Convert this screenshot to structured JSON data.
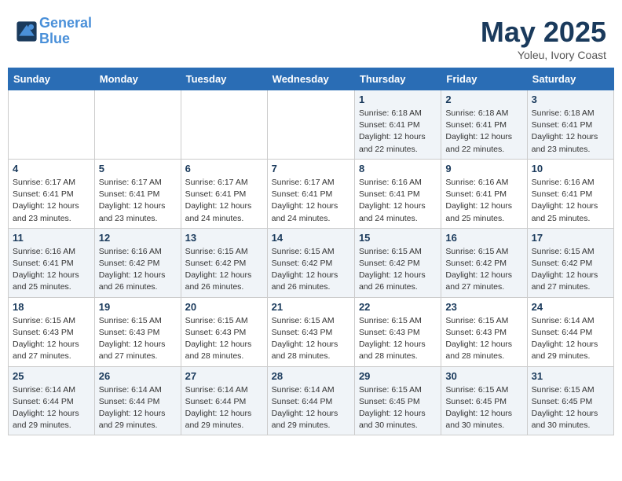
{
  "header": {
    "logo_line1": "General",
    "logo_line2": "Blue",
    "title": "May 2025",
    "subtitle": "Yoleu, Ivory Coast"
  },
  "weekdays": [
    "Sunday",
    "Monday",
    "Tuesday",
    "Wednesday",
    "Thursday",
    "Friday",
    "Saturday"
  ],
  "weeks": [
    [
      {
        "day": "",
        "info": ""
      },
      {
        "day": "",
        "info": ""
      },
      {
        "day": "",
        "info": ""
      },
      {
        "day": "",
        "info": ""
      },
      {
        "day": "1",
        "info": "Sunrise: 6:18 AM\nSunset: 6:41 PM\nDaylight: 12 hours\nand 22 minutes."
      },
      {
        "day": "2",
        "info": "Sunrise: 6:18 AM\nSunset: 6:41 PM\nDaylight: 12 hours\nand 22 minutes."
      },
      {
        "day": "3",
        "info": "Sunrise: 6:18 AM\nSunset: 6:41 PM\nDaylight: 12 hours\nand 23 minutes."
      }
    ],
    [
      {
        "day": "4",
        "info": "Sunrise: 6:17 AM\nSunset: 6:41 PM\nDaylight: 12 hours\nand 23 minutes."
      },
      {
        "day": "5",
        "info": "Sunrise: 6:17 AM\nSunset: 6:41 PM\nDaylight: 12 hours\nand 23 minutes."
      },
      {
        "day": "6",
        "info": "Sunrise: 6:17 AM\nSunset: 6:41 PM\nDaylight: 12 hours\nand 24 minutes."
      },
      {
        "day": "7",
        "info": "Sunrise: 6:17 AM\nSunset: 6:41 PM\nDaylight: 12 hours\nand 24 minutes."
      },
      {
        "day": "8",
        "info": "Sunrise: 6:16 AM\nSunset: 6:41 PM\nDaylight: 12 hours\nand 24 minutes."
      },
      {
        "day": "9",
        "info": "Sunrise: 6:16 AM\nSunset: 6:41 PM\nDaylight: 12 hours\nand 25 minutes."
      },
      {
        "day": "10",
        "info": "Sunrise: 6:16 AM\nSunset: 6:41 PM\nDaylight: 12 hours\nand 25 minutes."
      }
    ],
    [
      {
        "day": "11",
        "info": "Sunrise: 6:16 AM\nSunset: 6:41 PM\nDaylight: 12 hours\nand 25 minutes."
      },
      {
        "day": "12",
        "info": "Sunrise: 6:16 AM\nSunset: 6:42 PM\nDaylight: 12 hours\nand 26 minutes."
      },
      {
        "day": "13",
        "info": "Sunrise: 6:15 AM\nSunset: 6:42 PM\nDaylight: 12 hours\nand 26 minutes."
      },
      {
        "day": "14",
        "info": "Sunrise: 6:15 AM\nSunset: 6:42 PM\nDaylight: 12 hours\nand 26 minutes."
      },
      {
        "day": "15",
        "info": "Sunrise: 6:15 AM\nSunset: 6:42 PM\nDaylight: 12 hours\nand 26 minutes."
      },
      {
        "day": "16",
        "info": "Sunrise: 6:15 AM\nSunset: 6:42 PM\nDaylight: 12 hours\nand 27 minutes."
      },
      {
        "day": "17",
        "info": "Sunrise: 6:15 AM\nSunset: 6:42 PM\nDaylight: 12 hours\nand 27 minutes."
      }
    ],
    [
      {
        "day": "18",
        "info": "Sunrise: 6:15 AM\nSunset: 6:43 PM\nDaylight: 12 hours\nand 27 minutes."
      },
      {
        "day": "19",
        "info": "Sunrise: 6:15 AM\nSunset: 6:43 PM\nDaylight: 12 hours\nand 27 minutes."
      },
      {
        "day": "20",
        "info": "Sunrise: 6:15 AM\nSunset: 6:43 PM\nDaylight: 12 hours\nand 28 minutes."
      },
      {
        "day": "21",
        "info": "Sunrise: 6:15 AM\nSunset: 6:43 PM\nDaylight: 12 hours\nand 28 minutes."
      },
      {
        "day": "22",
        "info": "Sunrise: 6:15 AM\nSunset: 6:43 PM\nDaylight: 12 hours\nand 28 minutes."
      },
      {
        "day": "23",
        "info": "Sunrise: 6:15 AM\nSunset: 6:43 PM\nDaylight: 12 hours\nand 28 minutes."
      },
      {
        "day": "24",
        "info": "Sunrise: 6:14 AM\nSunset: 6:44 PM\nDaylight: 12 hours\nand 29 minutes."
      }
    ],
    [
      {
        "day": "25",
        "info": "Sunrise: 6:14 AM\nSunset: 6:44 PM\nDaylight: 12 hours\nand 29 minutes."
      },
      {
        "day": "26",
        "info": "Sunrise: 6:14 AM\nSunset: 6:44 PM\nDaylight: 12 hours\nand 29 minutes."
      },
      {
        "day": "27",
        "info": "Sunrise: 6:14 AM\nSunset: 6:44 PM\nDaylight: 12 hours\nand 29 minutes."
      },
      {
        "day": "28",
        "info": "Sunrise: 6:14 AM\nSunset: 6:44 PM\nDaylight: 12 hours\nand 29 minutes."
      },
      {
        "day": "29",
        "info": "Sunrise: 6:15 AM\nSunset: 6:45 PM\nDaylight: 12 hours\nand 30 minutes."
      },
      {
        "day": "30",
        "info": "Sunrise: 6:15 AM\nSunset: 6:45 PM\nDaylight: 12 hours\nand 30 minutes."
      },
      {
        "day": "31",
        "info": "Sunrise: 6:15 AM\nSunset: 6:45 PM\nDaylight: 12 hours\nand 30 minutes."
      }
    ]
  ]
}
